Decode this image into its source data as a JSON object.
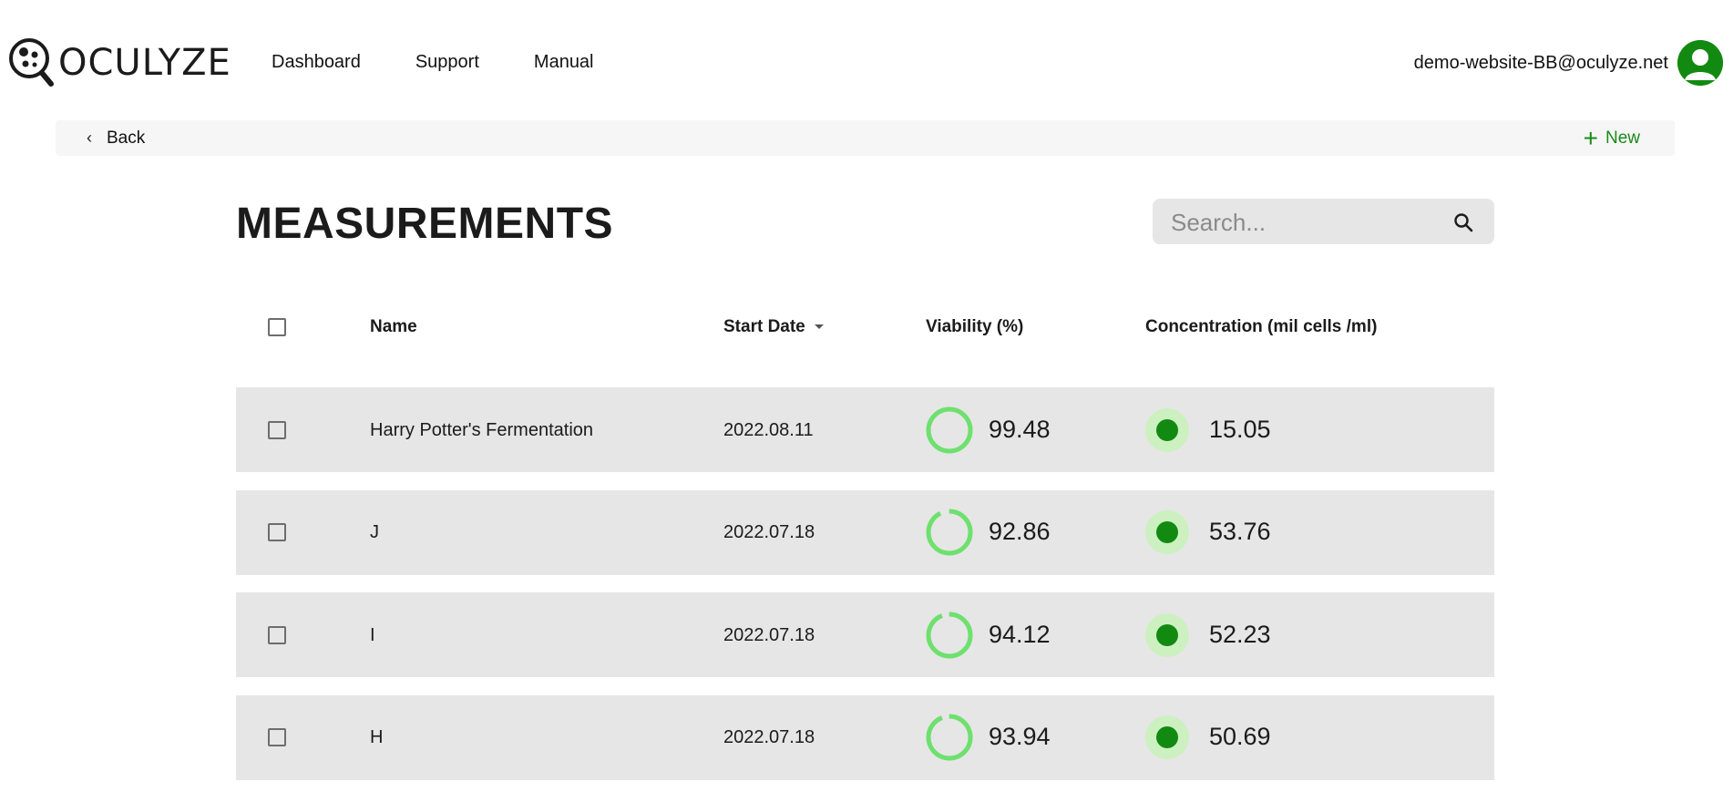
{
  "header": {
    "logo_text": "OCULYZE",
    "nav": [
      "Dashboard",
      "Support",
      "Manual"
    ],
    "user_email": "demo-website-BB@oculyze.net"
  },
  "actions": {
    "back_label": "Back",
    "new_label": "New"
  },
  "page": {
    "title": "MEASUREMENTS",
    "search_placeholder": "Search..."
  },
  "table": {
    "columns": [
      "Name",
      "Start Date",
      "Viability (%)",
      "Concentration (mil cells /ml)"
    ],
    "sort_column": "Start Date",
    "rows": [
      {
        "name": "Harry Potter's Fermentation",
        "start_date": "2022.08.11",
        "viability": "99.48",
        "concentration": "15.05"
      },
      {
        "name": "J",
        "start_date": "2022.07.18",
        "viability": "92.86",
        "concentration": "53.76"
      },
      {
        "name": "I",
        "start_date": "2022.07.18",
        "viability": "94.12",
        "concentration": "52.23"
      },
      {
        "name": "H",
        "start_date": "2022.07.18",
        "viability": "93.94",
        "concentration": "50.69"
      }
    ]
  },
  "colors": {
    "accent": "#1a8a1a",
    "ring": "#6ee06e",
    "dot_outer": "#cdf0c1",
    "dot_inner": "#128a12",
    "row_bg": "#e6e6e6"
  }
}
